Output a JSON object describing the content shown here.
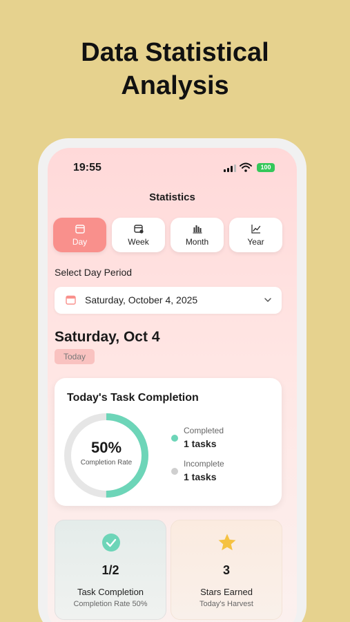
{
  "headline": {
    "line1": "Data Statistical",
    "line2": "Analysis"
  },
  "status_bar": {
    "time": "19:55",
    "battery": "100"
  },
  "screen_title": "Statistics",
  "tabs": [
    {
      "label": "Day",
      "icon": "calendar-icon",
      "active": true
    },
    {
      "label": "Week",
      "icon": "calendar-week-icon",
      "active": false
    },
    {
      "label": "Month",
      "icon": "bar-chart-icon",
      "active": false
    },
    {
      "label": "Year",
      "icon": "trend-chart-icon",
      "active": false
    }
  ],
  "period": {
    "label": "Select Day Period",
    "selected_date": "Saturday, October 4, 2025"
  },
  "day_heading": "Saturday, Oct 4",
  "today_badge": "Today",
  "completion_card": {
    "title": "Today's Task Completion",
    "percent": "50%",
    "rate_fraction": 0.5,
    "rate_label": "Completion Rate",
    "completed_label": "Completed",
    "completed_value": "1 tasks",
    "incomplete_label": "Incomplete",
    "incomplete_value": "1 tasks"
  },
  "stats": [
    {
      "value": "1/2",
      "label": "Task Completion",
      "sub": "Completion Rate 50%",
      "icon": "check-circle-icon"
    },
    {
      "value": "3",
      "label": "Stars Earned",
      "sub": "Today's Harvest",
      "icon": "star-icon"
    }
  ],
  "colors": {
    "background": "#E6D28E",
    "accent": "#F9908C",
    "completed": "#6DD5B8",
    "incomplete": "#CFCFCF",
    "star": "#F5C242",
    "battery": "#34C759"
  }
}
